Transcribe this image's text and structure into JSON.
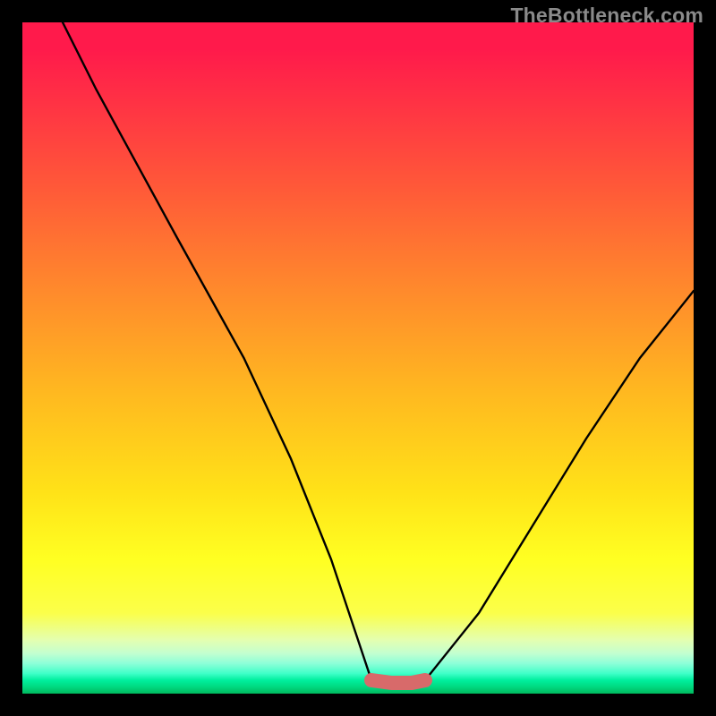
{
  "watermark": "TheBottleneck.com",
  "colors": {
    "accent_stroke": "#d86a6a",
    "line_stroke": "#000000"
  },
  "chart_data": {
    "type": "line",
    "title": "",
    "xlabel": "",
    "ylabel": "",
    "xlim": [
      0,
      100
    ],
    "ylim": [
      0,
      100
    ],
    "description": "V-shaped bottleneck curve on rainbow gradient. Y=0 (bottom) means no bottleneck (green); Y near 100 (top) means severe bottleneck (red). Left branch falls from top-left to a flat minimum near x≈52–60, right branch rises toward upper right.",
    "series": [
      {
        "name": "left_branch",
        "x": [
          6,
          11,
          23,
          33,
          40,
          46,
          50,
          52
        ],
        "y": [
          100,
          90,
          68,
          50,
          35,
          20,
          8,
          2
        ]
      },
      {
        "name": "right_branch",
        "x": [
          60,
          68,
          76,
          84,
          92,
          100
        ],
        "y": [
          2,
          12,
          25,
          38,
          50,
          60
        ]
      },
      {
        "name": "accent_flat",
        "x": [
          52,
          55,
          58,
          60
        ],
        "y": [
          2,
          1.6,
          1.6,
          2
        ]
      }
    ]
  }
}
